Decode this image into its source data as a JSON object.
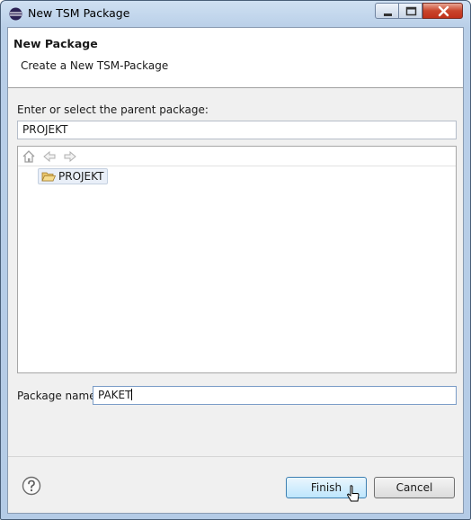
{
  "window": {
    "title": "New TSM Package"
  },
  "header": {
    "title": "New Package",
    "subtitle": "Create a New TSM-Package"
  },
  "form": {
    "parent_label": "Enter or select the parent package:",
    "parent_value": "PROJEKT",
    "tree": {
      "items": [
        {
          "label": "PROJEKT",
          "selected": true
        }
      ]
    },
    "package_name_label": "Package name:",
    "package_name_value": "PAKET"
  },
  "buttons": {
    "finish": "Finish",
    "cancel": "Cancel"
  },
  "colors": {
    "accent": "#3c7fb1",
    "close": "#c9452c"
  }
}
